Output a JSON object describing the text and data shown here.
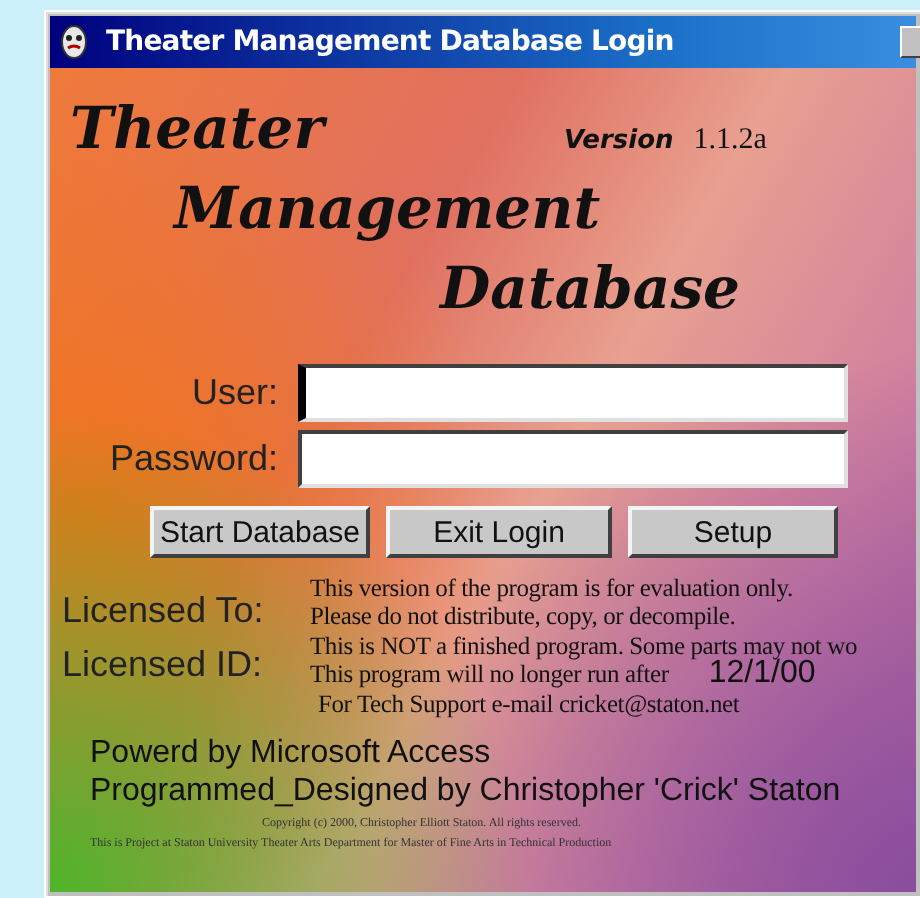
{
  "window": {
    "title": "Theater Management Database Login"
  },
  "logo": {
    "lines": [
      "Theater",
      "Management",
      "Database"
    ],
    "version_label": "Version",
    "version": "1.1.2a"
  },
  "fields": [
    {
      "label": "User:",
      "focused": true
    },
    {
      "label": "Password:",
      "focused": false
    }
  ],
  "buttons": [
    "Start Database",
    "Exit Login",
    "Setup"
  ],
  "license_labels": [
    "Licensed To:",
    "Licensed ID:"
  ],
  "notice": [
    "This version of the program is for evaluation only.",
    "Please do not distribute, copy, or decompile.",
    "This is NOT a finished program. Some parts may not wo",
    "This program will no longer run after",
    "For Tech Support e-mail cricket@staton.net"
  ],
  "expiry": "12/1/00",
  "credits": [
    "Powerd by Microsoft Access",
    "Programmed_Designed by Christopher 'Crick' Staton"
  ],
  "copyright": "Copyright (c) 2000, Christopher Elliott Staton.  All rights reserved.",
  "footer": "This is Project at Staton University Theater Arts Department for Master of Fine Arts in Technical Production"
}
